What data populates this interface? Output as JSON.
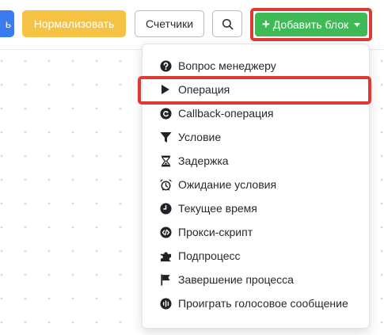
{
  "toolbar": {
    "blue_button_label": "ь",
    "normalize_label": "Нормализовать",
    "counters_label": "Счетчики",
    "search_icon": "search-icon",
    "add_block_label": "Добавить блок"
  },
  "dropdown": {
    "items": [
      {
        "label": "Вопрос менеджеру",
        "icon": "question-circle-icon"
      },
      {
        "label": "Операция",
        "icon": "play-icon"
      },
      {
        "label": "Callback-операция",
        "icon": "callback-icon"
      },
      {
        "label": "Условие",
        "icon": "filter-icon"
      },
      {
        "label": "Задержка",
        "icon": "hourglass-icon"
      },
      {
        "label": "Ожидание условия",
        "icon": "alarm-clock-icon"
      },
      {
        "label": "Текущее время",
        "icon": "clock-icon"
      },
      {
        "label": "Прокси-скрипт",
        "icon": "code-icon"
      },
      {
        "label": "Подпроцесс",
        "icon": "puzzle-icon"
      },
      {
        "label": "Завершение процесса",
        "icon": "flag-icon"
      },
      {
        "label": "Проиграть голосовое сообщение",
        "icon": "voice-message-icon"
      }
    ]
  },
  "colors": {
    "primary_blue": "#3a7cf0",
    "normalize_yellow": "#f6c244",
    "add_green": "#40b957",
    "highlight_red": "#dc3a35",
    "text_dark": "#25282d"
  }
}
